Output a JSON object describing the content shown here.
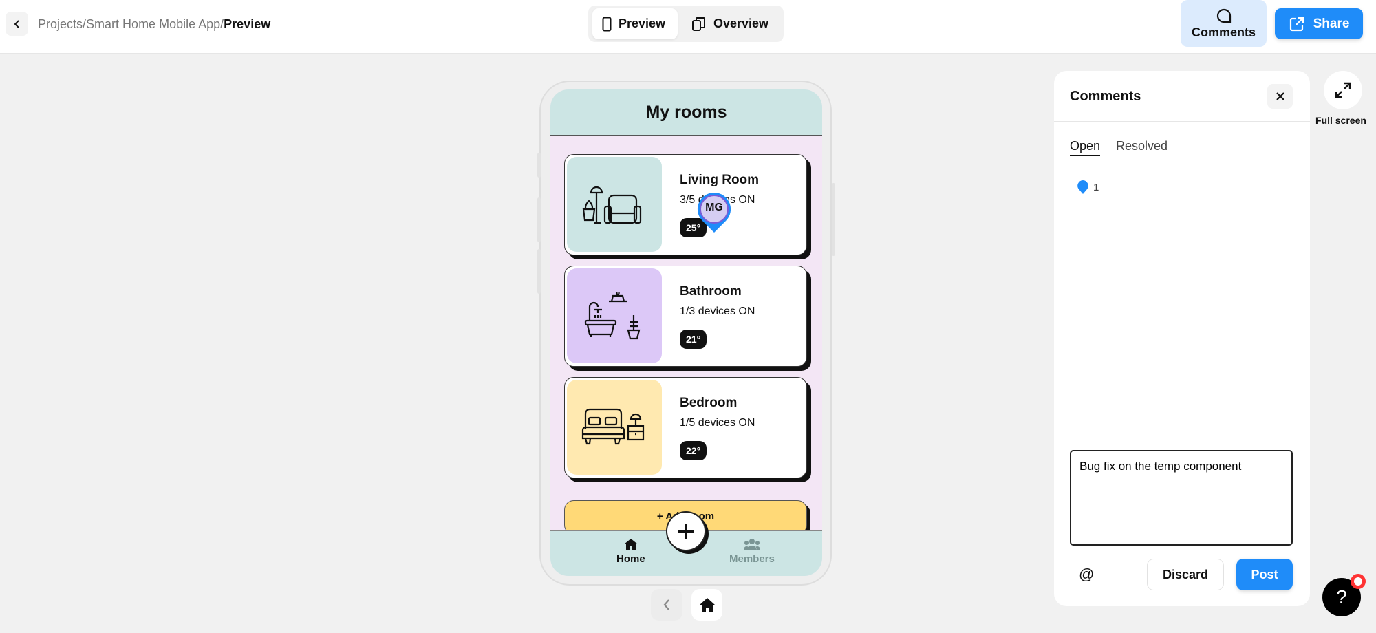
{
  "header": {
    "breadcrumb": [
      "Projects",
      "Smart Home Mobile App",
      "Preview"
    ],
    "separator": "/",
    "view_toggle": [
      {
        "label": "Preview",
        "icon": "phone-icon",
        "active": true
      },
      {
        "label": "Overview",
        "icon": "copy-icon",
        "active": false
      }
    ],
    "comments_label": "Comments",
    "share_label": "Share"
  },
  "app": {
    "title": "My rooms",
    "rooms": [
      {
        "name": "Living Room",
        "devices": "3/5 devices ON",
        "temp": "25°",
        "color": "#cce5e4",
        "icon": "living-room-icon"
      },
      {
        "name": "Bathroom",
        "devices": "1/3 devices ON",
        "temp": "21°",
        "color": "#dcc8f7",
        "icon": "bathroom-icon"
      },
      {
        "name": "Bedroom",
        "devices": "1/5 devices ON",
        "temp": "22°",
        "color": "#ffe9b0",
        "icon": "bedroom-icon"
      }
    ],
    "add_room_label": "+ Add room",
    "nav": [
      {
        "label": "Home",
        "icon": "home-icon",
        "active": true
      },
      {
        "label": "Members",
        "icon": "members-icon",
        "active": false
      }
    ],
    "comment_pin_initials": "MG"
  },
  "comments_panel": {
    "title": "Comments",
    "tabs": [
      {
        "label": "Open",
        "active": true
      },
      {
        "label": "Resolved",
        "active": false
      }
    ],
    "pin_count": "1",
    "input_value": "Bug fix on the temp component",
    "mention_symbol": "@",
    "discard_label": "Discard",
    "post_label": "Post"
  },
  "fullscreen_label": "Full screen",
  "help_symbol": "?",
  "colors": {
    "accent": "#1f8cf9",
    "comments_active_bg": "#dcebfd",
    "app_header": "#cce5e4",
    "app_bg": "#f3e6f5",
    "add_room": "#ffd977"
  }
}
